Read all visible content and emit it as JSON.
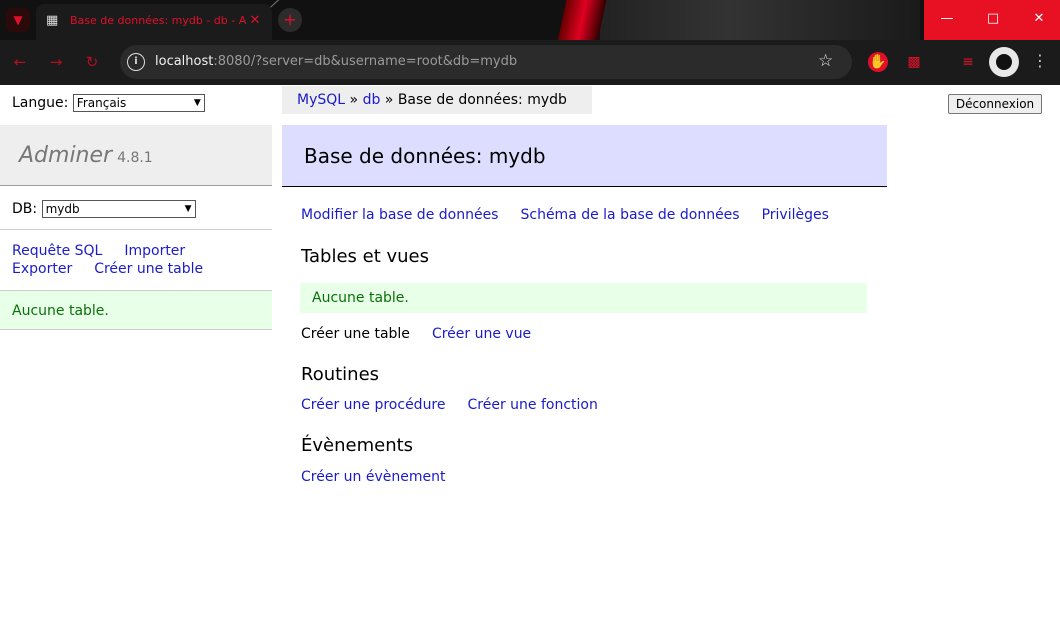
{
  "browser": {
    "tab_title": "Base de données: mydb - db - A",
    "url_host": "localhost",
    "url_rest": ":8080/?server=db&username=root&db=mydb"
  },
  "header": {
    "language_label": "Langue:",
    "language_value": "Français",
    "logout_label": "Déconnexion"
  },
  "breadcrumb": {
    "item1": "MySQL",
    "sep1": "»",
    "item2": "db",
    "sep2": "»",
    "current": "Base de données: mydb"
  },
  "sidebar": {
    "app_name": "Adminer",
    "version": "4.8.1",
    "db_label": "DB:",
    "db_value": "mydb",
    "links": [
      "Requête SQL",
      "Importer",
      "Exporter",
      "Créer une table"
    ],
    "message": "Aucune table."
  },
  "main": {
    "title": "Base de données: mydb",
    "db_links": [
      "Modifier la base de données",
      "Schéma de la base de données",
      "Privilèges"
    ],
    "tables_heading": "Tables et vues",
    "tables_message": "Aucune table.",
    "create_table": "Créer une table",
    "create_view": "Créer une vue",
    "routines_heading": "Routines",
    "create_procedure": "Créer une procédure",
    "create_function": "Créer une fonction",
    "events_heading": "Évènements",
    "create_event": "Créer un évènement"
  },
  "colors": {
    "link": "#1b1bc7",
    "header_bg": "#ddddff",
    "message_bg": "#e8ffe8",
    "message_text": "#0a700a",
    "browser_accent": "#e0102a"
  }
}
